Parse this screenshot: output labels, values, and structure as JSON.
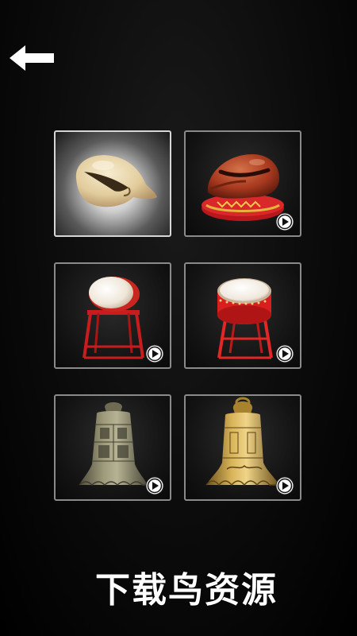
{
  "header": {
    "back_icon": "left-arrow-icon"
  },
  "instruments": [
    {
      "id": "muyu-plain",
      "icon": "wooden-fish-icon",
      "selected": true,
      "has_play": false,
      "colors": {
        "body": "#e9d8b0",
        "shade": "#b79c6a"
      }
    },
    {
      "id": "muyu-red",
      "icon": "red-wooden-fish-icon",
      "selected": false,
      "has_play": true,
      "colors": {
        "body": "#b3462a",
        "cushion": "#d8282a",
        "trim": "#e2b53c"
      }
    },
    {
      "id": "drum-white",
      "icon": "drum-on-stand-icon",
      "selected": false,
      "has_play": true,
      "colors": {
        "head": "#f2ece3",
        "shell": "#c8261f",
        "stand": "#c91d1d"
      }
    },
    {
      "id": "drum-red",
      "icon": "red-drum-on-stand-icon",
      "selected": false,
      "has_play": true,
      "colors": {
        "head": "#f3eee6",
        "shell": "#d81e1e",
        "stand": "#e32626"
      }
    },
    {
      "id": "bell-bronze",
      "icon": "bronze-bell-icon",
      "selected": false,
      "has_play": true,
      "colors": {
        "metal": "#8d8a6a",
        "shade": "#4e4b3b"
      }
    },
    {
      "id": "bell-gold",
      "icon": "golden-bell-icon",
      "selected": false,
      "has_play": true,
      "colors": {
        "metal": "#c9a24a",
        "shade": "#7a5d22"
      }
    }
  ],
  "play_icon": "play-circle-icon",
  "watermark": {
    "text": "下载鸟资源"
  },
  "colors": {
    "background": "#000000",
    "tile_border": "#8a8a8a",
    "selected_border": "#d6d6d6",
    "icon_white": "#ffffff"
  }
}
